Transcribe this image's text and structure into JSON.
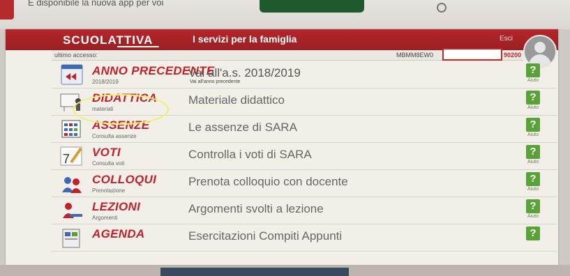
{
  "top": {
    "notice": "È disponibile la nuova app per voi"
  },
  "header": {
    "logo": "SCUOLATTIVA",
    "tagline": "I servizi per la famiglia",
    "logout": "Esci"
  },
  "access": {
    "label": "ultimo accesso:",
    "user_code": "MBMM8EW0",
    "user_suffix": "90200"
  },
  "menu": [
    {
      "title": "ANNO PRECEDENTE",
      "subtitle": "2018/2019",
      "desc": "Vai all'a.s. 2018/2019",
      "desc_sub": "Vai all'anno precedente",
      "help": "Aiuto",
      "icon": "back-arrow-icon"
    },
    {
      "title": "DIDATTICA",
      "subtitle": "materiali",
      "desc": "Materiale didattico",
      "desc_sub": "",
      "help": "Aiuto",
      "icon": "teacher-board-icon"
    },
    {
      "title": "ASSENZE",
      "subtitle": "Consulta assenze",
      "desc": "Le assenze di SARA",
      "desc_sub": "",
      "help": "Aiuto",
      "icon": "calendar-icon"
    },
    {
      "title": "VOTI",
      "subtitle": "Consulta voti",
      "desc": "Controlla i voti di SARA",
      "desc_sub": "",
      "help": "Aiuto",
      "icon": "grade-pencil-icon"
    },
    {
      "title": "COLLOQUI",
      "subtitle": "Prenotazione",
      "desc": "Prenota colloquio con docente",
      "desc_sub": "",
      "help": "Aiuto",
      "icon": "people-icon"
    },
    {
      "title": "LEZIONI",
      "subtitle": "Argomenti",
      "desc": "Argomenti svolti a lezione",
      "desc_sub": "",
      "help": "Aiuto",
      "icon": "lesson-desk-icon"
    },
    {
      "title": "AGENDA",
      "subtitle": "",
      "desc": "Esercitazioni Compiti Appunti",
      "desc_sub": "",
      "help": "",
      "icon": "agenda-icon"
    }
  ],
  "help_glyph": "?",
  "colors": {
    "brand_red": "#b3262a",
    "help_green": "#58a238",
    "highlight": "#f1f06b"
  }
}
